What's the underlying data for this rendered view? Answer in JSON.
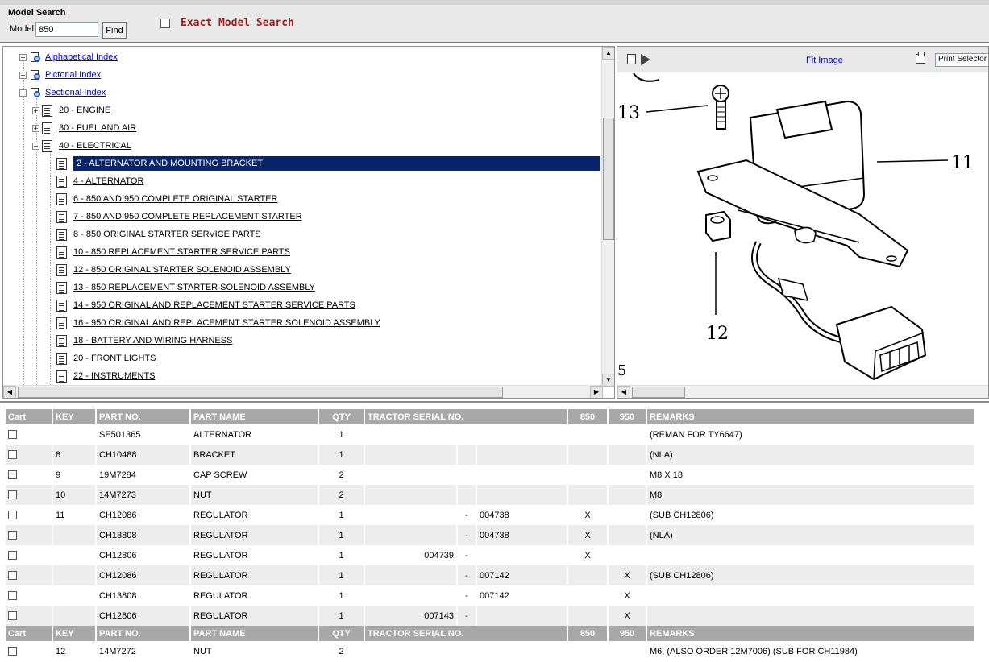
{
  "search": {
    "title": "Model Search",
    "model_label": "Model",
    "model_value": "850",
    "find_label": "Find",
    "exact_label": "Exact Model Search"
  },
  "tree": {
    "items": [
      {
        "label": "Alphabetical Index",
        "expander": "+",
        "icon": "index-book-icon"
      },
      {
        "label": "Pictorial Index",
        "expander": "+",
        "icon": "index-book-icon"
      },
      {
        "label": "Sectional Index",
        "expander": "−",
        "icon": "index-book-icon"
      },
      {
        "label": "20 - ENGINE",
        "expander": "+",
        "icon": "section-doc-icon"
      },
      {
        "label": "30 - FUEL AND AIR",
        "expander": "+",
        "icon": "section-doc-icon"
      },
      {
        "label": "40 - ELECTRICAL",
        "expander": "−",
        "icon": "section-doc-icon"
      },
      {
        "label": "2 - ALTERNATOR AND MOUNTING BRACKET",
        "selected": true,
        "icon": "page-doc-icon"
      },
      {
        "label": "4 - ALTERNATOR",
        "icon": "page-doc-icon"
      },
      {
        "label": "6 - 850 AND 950 COMPLETE ORIGINAL STARTER",
        "icon": "page-doc-icon"
      },
      {
        "label": "7 - 850 AND 950 COMPLETE REPLACEMENT STARTER",
        "icon": "page-doc-icon"
      },
      {
        "label": "8 - 850 ORIGINAL STARTER SERVICE PARTS",
        "icon": "page-doc-icon"
      },
      {
        "label": "10 - 850 REPLACEMENT STARTER SERVICE PARTS",
        "icon": "page-doc-icon"
      },
      {
        "label": "12 - 850 ORIGINAL STARTER SOLENOID ASSEMBLY",
        "icon": "page-doc-icon"
      },
      {
        "label": "13 - 850 REPLACEMENT STARTER SOLENOID ASSEMBLY",
        "icon": "page-doc-icon"
      },
      {
        "label": "14 - 950 ORIGINAL AND REPLACEMENT STARTER SERVICE PARTS",
        "icon": "page-doc-icon"
      },
      {
        "label": "16 - 950 ORIGINAL AND REPLACEMENT STARTER SOLENOID ASSEMBLY",
        "icon": "page-doc-icon"
      },
      {
        "label": "18 - BATTERY AND WIRING HARNESS",
        "icon": "page-doc-icon"
      },
      {
        "label": "20 - FRONT LIGHTS",
        "icon": "page-doc-icon"
      },
      {
        "label": "22 - INSTRUMENTS",
        "icon": "page-doc-icon"
      }
    ]
  },
  "image_toolbar": {
    "fit_label": "Fit Image",
    "print_select_value": "Print Selector"
  },
  "diagram": {
    "callouts": [
      "13",
      "11",
      "12",
      "5"
    ]
  },
  "table": {
    "headers": {
      "cart": "Cart",
      "key": "KEY",
      "part_no": "PART NO.",
      "part_name": "PART NAME",
      "qty": "QTY",
      "serial": "TRACTOR SERIAL NO.",
      "m850": "850",
      "m950": "950",
      "remarks": "REMARKS"
    },
    "rows": [
      {
        "key": "",
        "part_no": "SE501365",
        "name": "ALTERNATOR",
        "qty": "1",
        "from": "",
        "dash": "",
        "to": "",
        "m850": "",
        "m950": "",
        "remarks": "(REMAN FOR TY6647)"
      },
      {
        "key": "8",
        "part_no": "CH10488",
        "name": "BRACKET",
        "qty": "1",
        "from": "",
        "dash": "",
        "to": "",
        "m850": "",
        "m950": "",
        "remarks": "(NLA)"
      },
      {
        "key": "9",
        "part_no": "19M7284",
        "name": "CAP SCREW",
        "qty": "2",
        "from": "",
        "dash": "",
        "to": "",
        "m850": "",
        "m950": "",
        "remarks": "M8 X 18"
      },
      {
        "key": "10",
        "part_no": "14M7273",
        "name": "NUT",
        "qty": "2",
        "from": "",
        "dash": "",
        "to": "",
        "m850": "",
        "m950": "",
        "remarks": "M8"
      },
      {
        "key": "11",
        "part_no": "CH12086",
        "name": "REGULATOR",
        "qty": "1",
        "from": "",
        "dash": "-",
        "to": "004738",
        "m850": "X",
        "m950": "",
        "remarks": "(SUB CH12806)"
      },
      {
        "key": "",
        "part_no": "CH13808",
        "name": "REGULATOR",
        "qty": "1",
        "from": "",
        "dash": "-",
        "to": "004738",
        "m850": "X",
        "m950": "",
        "remarks": "(NLA)"
      },
      {
        "key": "",
        "part_no": "CH12806",
        "name": "REGULATOR",
        "qty": "1",
        "from": "004739",
        "dash": "-",
        "to": "",
        "m850": "X",
        "m950": "",
        "remarks": ""
      },
      {
        "key": "",
        "part_no": "CH12086",
        "name": "REGULATOR",
        "qty": "1",
        "from": "",
        "dash": "-",
        "to": "007142",
        "m850": "",
        "m950": "X",
        "remarks": "(SUB CH12806)"
      },
      {
        "key": "",
        "part_no": "CH13808",
        "name": "REGULATOR",
        "qty": "1",
        "from": "",
        "dash": "-",
        "to": "007142",
        "m850": "",
        "m950": "X",
        "remarks": ""
      },
      {
        "key": "",
        "part_no": "CH12806",
        "name": "REGULATOR",
        "qty": "1",
        "from": "007143",
        "dash": "-",
        "to": "",
        "m850": "",
        "m950": "X",
        "remarks": ""
      }
    ],
    "rows_b": [
      {
        "key": "12",
        "part_no": "14M7272",
        "name": "NUT",
        "qty": "2",
        "from": "",
        "dash": "",
        "to": "",
        "m850": "",
        "m950": "",
        "remarks": "M6, (ALSO ORDER 12M7006) (SUB FOR CH11984)"
      }
    ]
  }
}
